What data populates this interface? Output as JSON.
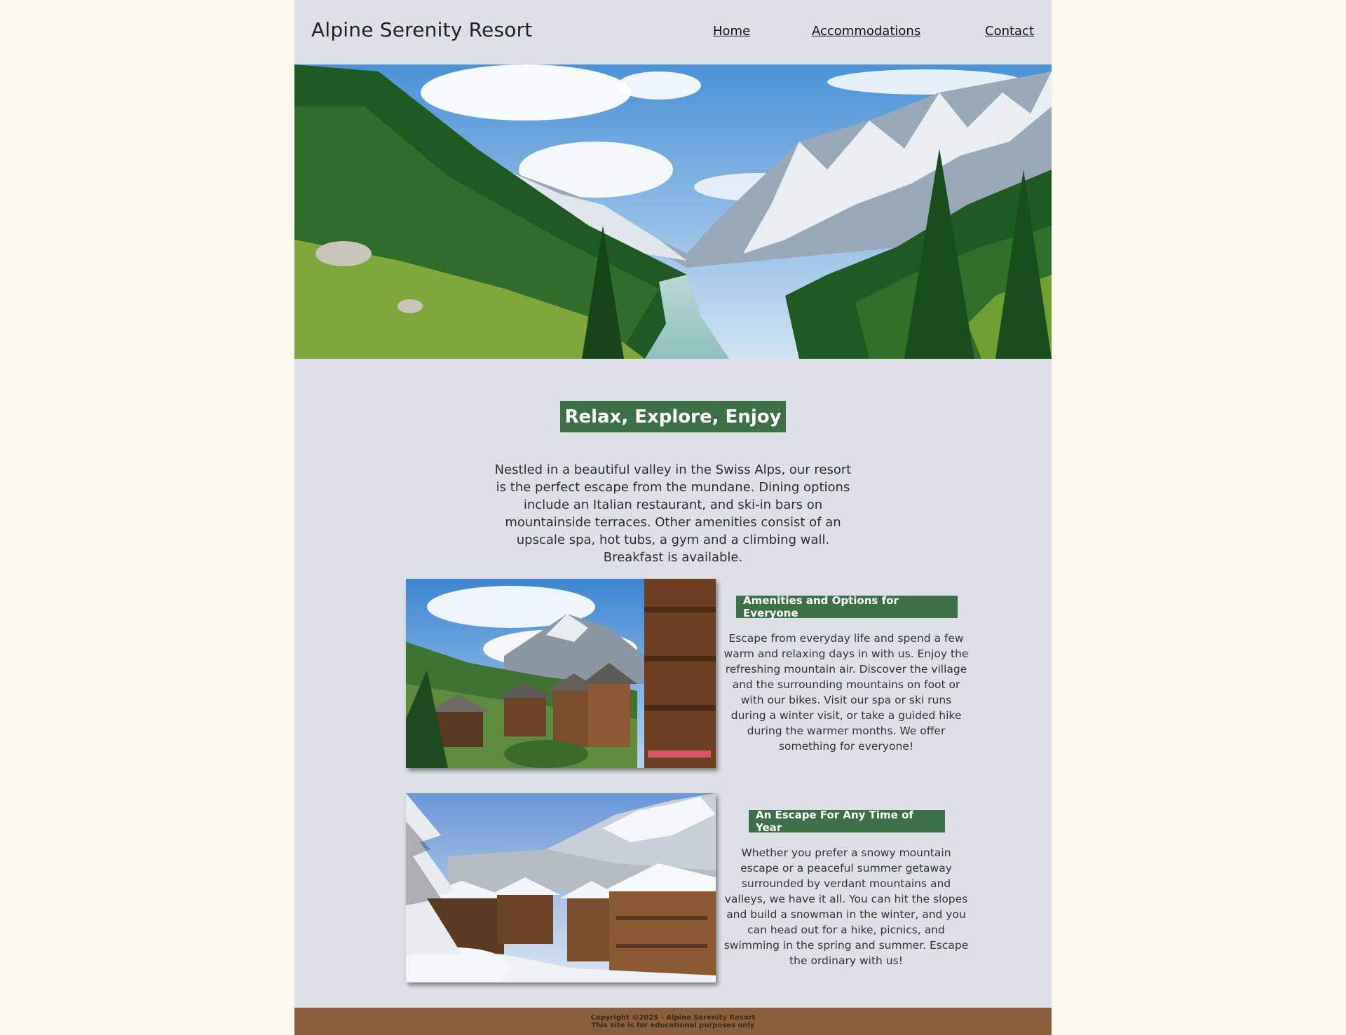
{
  "header": {
    "site_title": "Alpine Serenity Resort",
    "nav": [
      "Home",
      "Accommodations",
      "Contact"
    ]
  },
  "hero": {
    "image_name": "alpine-valley-hero-image"
  },
  "intro": {
    "heading": "Relax, Explore, Enjoy",
    "text": "Nestled in a beautiful valley in the Swiss Alps, our resort is the perfect escape from the mundane. Dining options include an Italian restaurant, and ski-in bars on mountainside terraces. Other amenities consist of an upscale spa, hot tubs, a gym and a climbing wall. Breakfast is available."
  },
  "features": [
    {
      "heading": "Amenities and Options for Everyone",
      "text": "Escape from everyday life and spend a few warm and relaxing days in with us. Enjoy the refreshing mountain air. Discover the village and the surrounding mountains on foot or with our bikes. Visit our spa or ski runs during a winter visit, or take a guided hike during the warmer months. We offer something for everyone!",
      "image_name": "summer-village-image"
    },
    {
      "heading": "An Escape For Any Time of Year",
      "text": "Whether you prefer a snowy mountain escape or a peaceful summer getaway surrounded by verdant mountains and valleys, we have it all. You can hit the slopes and build a snowman in the winter, and you can head out for a hike, picnics, and swimming in the spring and summer. Escape the ordinary with us!",
      "image_name": "winter-village-image"
    }
  ],
  "footer": {
    "copyright": "Copyright ©2025 - Alpine Serenity Resort",
    "note": "This site is for educational purposes only"
  },
  "colors": {
    "page_bg": "#fdf9ee",
    "content_bg": "#dde1e7",
    "accent_green": "#3c7047",
    "footer_brown": "#8b5e3c"
  }
}
